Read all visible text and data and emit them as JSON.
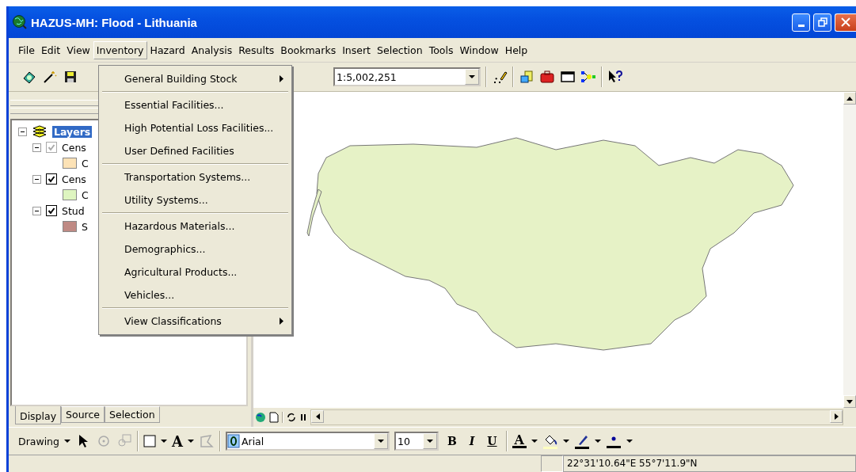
{
  "window": {
    "title": "HAZUS-MH: Flood - Lithuania"
  },
  "menu_bar": [
    {
      "label": "File",
      "selected": false
    },
    {
      "label": "Edit",
      "selected": false
    },
    {
      "label": "View",
      "selected": false
    },
    {
      "label": "Inventory",
      "selected": true
    },
    {
      "label": "Hazard",
      "selected": false
    },
    {
      "label": "Analysis",
      "selected": false
    },
    {
      "label": "Results",
      "selected": false
    },
    {
      "label": "Bookmarks",
      "selected": false
    },
    {
      "label": "Insert",
      "selected": false
    },
    {
      "label": "Selection",
      "selected": false
    },
    {
      "label": "Tools",
      "selected": false
    },
    {
      "label": "Window",
      "selected": false
    },
    {
      "label": "Help",
      "selected": false
    }
  ],
  "scale_box": {
    "value": "1:5,002,251"
  },
  "inventory_menu": [
    [
      {
        "label": "General Building Stock",
        "submenu": true
      }
    ],
    [
      {
        "label": "Essential Facilities...",
        "submenu": false
      },
      {
        "label": "High Potential Loss Facilities...",
        "submenu": false
      },
      {
        "label": "User Defined Facilities",
        "submenu": false
      }
    ],
    [
      {
        "label": "Transportation Systems...",
        "submenu": false
      },
      {
        "label": "Utility Systems...",
        "submenu": false
      }
    ],
    [
      {
        "label": "Hazardous Materials...",
        "submenu": false
      },
      {
        "label": "Demographics...",
        "submenu": false
      },
      {
        "label": "Agricultural Products...",
        "submenu": false
      },
      {
        "label": "Vehicles...",
        "submenu": false
      }
    ],
    [
      {
        "label": "View Classifications",
        "submenu": true
      }
    ]
  ],
  "toc": {
    "root": {
      "label": "Layers",
      "selected": true,
      "expanded": true
    },
    "layers": [
      {
        "label": "Cens",
        "checked": true,
        "disabled": true,
        "expanded": true,
        "legend": [
          {
            "label": "C",
            "color": "#fce2b6"
          }
        ]
      },
      {
        "label": "Cens",
        "checked": true,
        "disabled": false,
        "expanded": true,
        "legend": [
          {
            "label": "C",
            "color": "#def5c0"
          }
        ]
      },
      {
        "label": "Stud",
        "checked": true,
        "disabled": false,
        "expanded": true,
        "legend": [
          {
            "label": "S",
            "color": "#bf8a84"
          }
        ]
      }
    ],
    "tabs": [
      {
        "label": "Display",
        "selected": true
      },
      {
        "label": "Source",
        "selected": false
      },
      {
        "label": "Selection",
        "selected": false
      }
    ]
  },
  "drawing_toolbar": {
    "menu_label": "Drawing",
    "text_tool": "A",
    "font": "Arial",
    "font_size": "10",
    "format_buttons": [
      "B",
      "I",
      "U"
    ],
    "font_color_label": "A"
  },
  "status_bar": {
    "coordinates": "22°31'10.64\"E  55°7'11.9\"N"
  }
}
